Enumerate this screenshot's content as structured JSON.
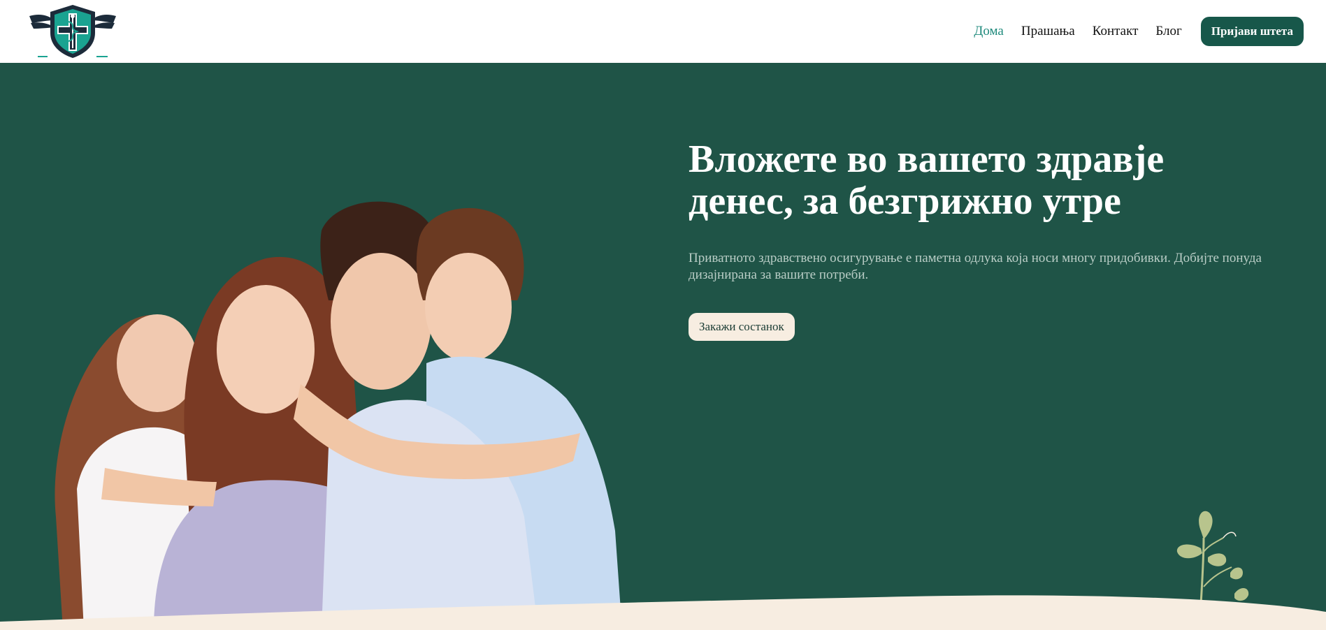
{
  "nav": {
    "items": [
      {
        "label": "Дома",
        "active": true
      },
      {
        "label": "Прашања",
        "active": false
      },
      {
        "label": "Контакт",
        "active": false
      },
      {
        "label": "Блог",
        "active": false
      }
    ],
    "cta_label": "Пријави штета"
  },
  "hero": {
    "title_line1": "Вложете во вашето здравје",
    "title_line2": "денес, за безгрижно утре",
    "text": "Приватното здравствено осигурување е паметна одлука која носи многу придобивки. Добијте понуда дизајнирана за вашите потреби.",
    "button_label": "Закажи состанок"
  },
  "colors": {
    "hero_bg": "#1f5447",
    "accent": "#1f8a7c",
    "button_dark": "#17574a",
    "cream": "#f7ede1"
  },
  "icons": {
    "logo": "medical-shield-caduceus-wings",
    "decoration": "leaf-plant"
  }
}
